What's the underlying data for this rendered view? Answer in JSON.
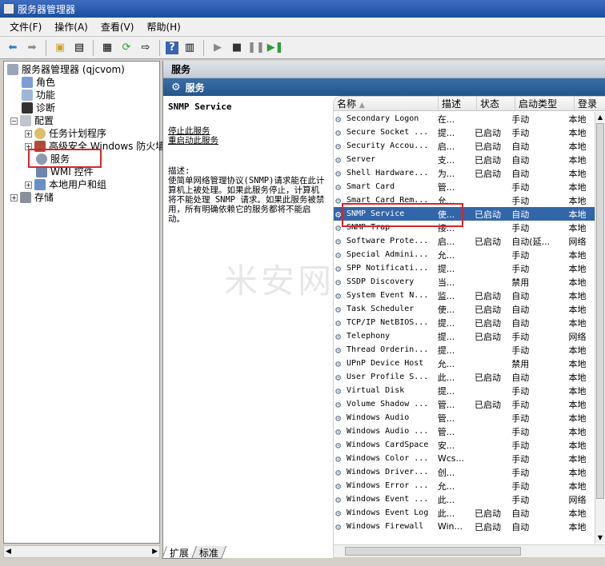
{
  "window": {
    "title": "服务器管理器"
  },
  "menu": [
    "文件(F)",
    "操作(A)",
    "查看(V)",
    "帮助(H)"
  ],
  "toolbar_icons": [
    "back-icon",
    "forward-icon",
    "up-folder-icon",
    "show-hide-tree-icon",
    "properties-icon",
    "refresh-icon",
    "export-icon",
    "help-icon",
    "console-icon",
    "play-icon",
    "stop-icon",
    "pause-icon",
    "restart-icon"
  ],
  "tree": {
    "root": "服务器管理器 (qjcvom)",
    "roles": "角色",
    "features": "功能",
    "diagnostics": "诊断",
    "config": "配置",
    "task_scheduler": "任务计划程序",
    "firewall": "高级安全 Windows 防火墙",
    "services": "服务",
    "wmi": "WMI 控件",
    "local_users": "本地用户和组",
    "storage": "存储"
  },
  "pane": {
    "header": "服务",
    "band": "服务",
    "selected_service": "SNMP Service",
    "stop_link": "停止此服务",
    "restart_link": "重启动此服务",
    "desc_label": "描述:",
    "desc_text": "使简单网络管理协议(SNMP)请求能在此计算机上被处理。如果此服务停止，计算机将不能处理 SNMP 请求。如果此服务被禁用，所有明确依赖它的服务都将不能启动。"
  },
  "columns": {
    "name": "名称",
    "desc": "描述",
    "status": "状态",
    "startup": "启动类型",
    "logon": "登录"
  },
  "services": [
    {
      "name": "Secondary Logon",
      "desc": "在...",
      "status": "",
      "startup": "手动",
      "logon": "本地"
    },
    {
      "name": "Secure Socket ...",
      "desc": "提...",
      "status": "已启动",
      "startup": "手动",
      "logon": "本地"
    },
    {
      "name": "Security Accou...",
      "desc": "启...",
      "status": "已启动",
      "startup": "自动",
      "logon": "本地"
    },
    {
      "name": "Server",
      "desc": "支...",
      "status": "已启动",
      "startup": "自动",
      "logon": "本地"
    },
    {
      "name": "Shell Hardware...",
      "desc": "为...",
      "status": "已启动",
      "startup": "自动",
      "logon": "本地"
    },
    {
      "name": "Smart Card",
      "desc": "管...",
      "status": "",
      "startup": "手动",
      "logon": "本地"
    },
    {
      "name": "Smart Card Rem...",
      "desc": "允...",
      "status": "",
      "startup": "手动",
      "logon": "本地"
    },
    {
      "name": "SNMP Service",
      "desc": "使...",
      "status": "已启动",
      "startup": "自动",
      "logon": "本地"
    },
    {
      "name": "SNMP Trap",
      "desc": "接...",
      "status": "",
      "startup": "手动",
      "logon": "本地"
    },
    {
      "name": "Software Prote...",
      "desc": "启...",
      "status": "已启动",
      "startup": "自动(延...",
      "logon": "网络"
    },
    {
      "name": "Special Admini...",
      "desc": "允...",
      "status": "",
      "startup": "手动",
      "logon": "本地"
    },
    {
      "name": "SPP Notificati...",
      "desc": "提...",
      "status": "",
      "startup": "手动",
      "logon": "本地"
    },
    {
      "name": "SSDP Discovery",
      "desc": "当...",
      "status": "",
      "startup": "禁用",
      "logon": "本地"
    },
    {
      "name": "System Event N...",
      "desc": "监...",
      "status": "已启动",
      "startup": "自动",
      "logon": "本地"
    },
    {
      "name": "Task Scheduler",
      "desc": "使...",
      "status": "已启动",
      "startup": "自动",
      "logon": "本地"
    },
    {
      "name": "TCP/IP NetBIOS...",
      "desc": "提...",
      "status": "已启动",
      "startup": "自动",
      "logon": "本地"
    },
    {
      "name": "Telephony",
      "desc": "提...",
      "status": "已启动",
      "startup": "手动",
      "logon": "网络"
    },
    {
      "name": "Thread Orderin...",
      "desc": "提...",
      "status": "",
      "startup": "手动",
      "logon": "本地"
    },
    {
      "name": "UPnP Device Host",
      "desc": "允...",
      "status": "",
      "startup": "禁用",
      "logon": "本地"
    },
    {
      "name": "User Profile S...",
      "desc": "此...",
      "status": "已启动",
      "startup": "自动",
      "logon": "本地"
    },
    {
      "name": "Virtual Disk",
      "desc": "提...",
      "status": "",
      "startup": "手动",
      "logon": "本地"
    },
    {
      "name": "Volume Shadow ...",
      "desc": "管...",
      "status": "已启动",
      "startup": "手动",
      "logon": "本地"
    },
    {
      "name": "Windows Audio",
      "desc": "管...",
      "status": "",
      "startup": "手动",
      "logon": "本地"
    },
    {
      "name": "Windows Audio ...",
      "desc": "管...",
      "status": "",
      "startup": "手动",
      "logon": "本地"
    },
    {
      "name": "Windows CardSpace",
      "desc": "安...",
      "status": "",
      "startup": "手动",
      "logon": "本地"
    },
    {
      "name": "Windows Color ...",
      "desc": "Wcs...",
      "status": "",
      "startup": "手动",
      "logon": "本地"
    },
    {
      "name": "Windows Driver...",
      "desc": "创...",
      "status": "",
      "startup": "手动",
      "logon": "本地"
    },
    {
      "name": "Windows Error ...",
      "desc": "允...",
      "status": "",
      "startup": "手动",
      "logon": "本地"
    },
    {
      "name": "Windows Event ...",
      "desc": "此...",
      "status": "",
      "startup": "手动",
      "logon": "网络"
    },
    {
      "name": "Windows Event Log",
      "desc": "此...",
      "status": "已启动",
      "startup": "自动",
      "logon": "本地"
    },
    {
      "name": "Windows Firewall",
      "desc": "Win...",
      "status": "已启动",
      "startup": "自动",
      "logon": "本地"
    }
  ],
  "selected_index": 7,
  "bottom_tabs": [
    "扩展",
    "标准"
  ],
  "watermark": "米安网"
}
